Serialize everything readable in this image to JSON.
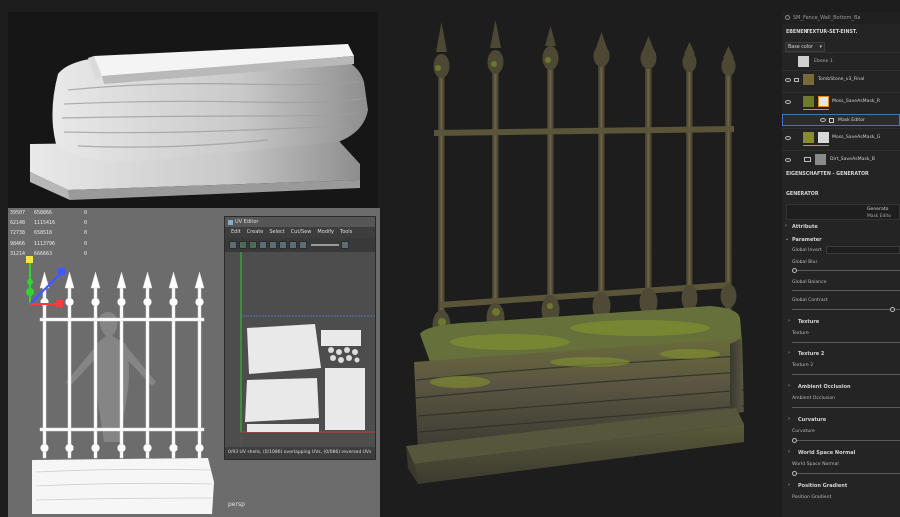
{
  "hud": {
    "rows": [
      {
        "a": "39507",
        "b": "658866",
        "c": "0"
      },
      {
        "a": "62148",
        "b": "1115416",
        "c": "0"
      },
      {
        "a": "72738",
        "b": "658518",
        "c": "0"
      },
      {
        "a": "98466",
        "b": "1113796",
        "c": "0"
      },
      {
        "a": "31214",
        "b": "666663",
        "c": "0"
      }
    ],
    "camera": "persp"
  },
  "uv_editor": {
    "title": "UV Editor",
    "menu": [
      "Edit",
      "Create",
      "Select",
      "Cut/Sew",
      "Modify",
      "Tools"
    ],
    "status": "0/93 UV shells, (0/1086) overlapping UVs, (0/086) reversed UVs"
  },
  "panel": {
    "header_title": "SM_Fence_Wall_Bottom_Ba",
    "tab_layers": "EBENEN",
    "tab_texture_set": "TEXTUR-SET-EINST.",
    "channel": "Base color",
    "layers": [
      {
        "name": "Ebene 1",
        "thumb": "#cfcfcf"
      },
      {
        "name": "TombStone_v3_Final",
        "thumb": "#7a6a3a"
      },
      {
        "name": "Moss_SaveAsMask_R",
        "thumb": "#6f7a2a",
        "has_mask": true
      },
      {
        "name": "Mask Editor",
        "thumb": "#e8e8e8",
        "child": true
      },
      {
        "name": "Moss_SaveAsMask_G",
        "thumb": "#8a8a2e",
        "has_mask": true
      },
      {
        "name": "Dirt_SaveAsMask_B",
        "thumb": "#8a8a8a",
        "folder": true
      }
    ],
    "properties_title": "EIGENSCHAFTEN - GENERATOR",
    "generator_title": "GENERATOR",
    "generator_name": "Generato",
    "generator_sub": "Mask Edito",
    "sections": [
      {
        "title": "Attribute",
        "items": []
      },
      {
        "title": "Parameter",
        "items": [
          "Global Invert",
          "Global Blur",
          "Global Balance",
          "Global Contrast"
        ]
      },
      {
        "title": "Texture",
        "items": [
          "Texture"
        ]
      },
      {
        "title": "Texture 2",
        "items": [
          "Texture 2"
        ]
      },
      {
        "title": "Ambient Occlusion",
        "items": [
          "Ambient Occlusion"
        ]
      },
      {
        "title": "Curvature",
        "items": [
          "Curvature"
        ]
      },
      {
        "title": "World Space Normal",
        "items": [
          "World Space Normal"
        ]
      },
      {
        "title": "Position Gradient",
        "items": [
          "Position Gradient"
        ]
      }
    ]
  },
  "colors": {
    "accent_orange": "#e8891f",
    "panel_bg": "#242424",
    "moss": "#7a8a2c"
  }
}
